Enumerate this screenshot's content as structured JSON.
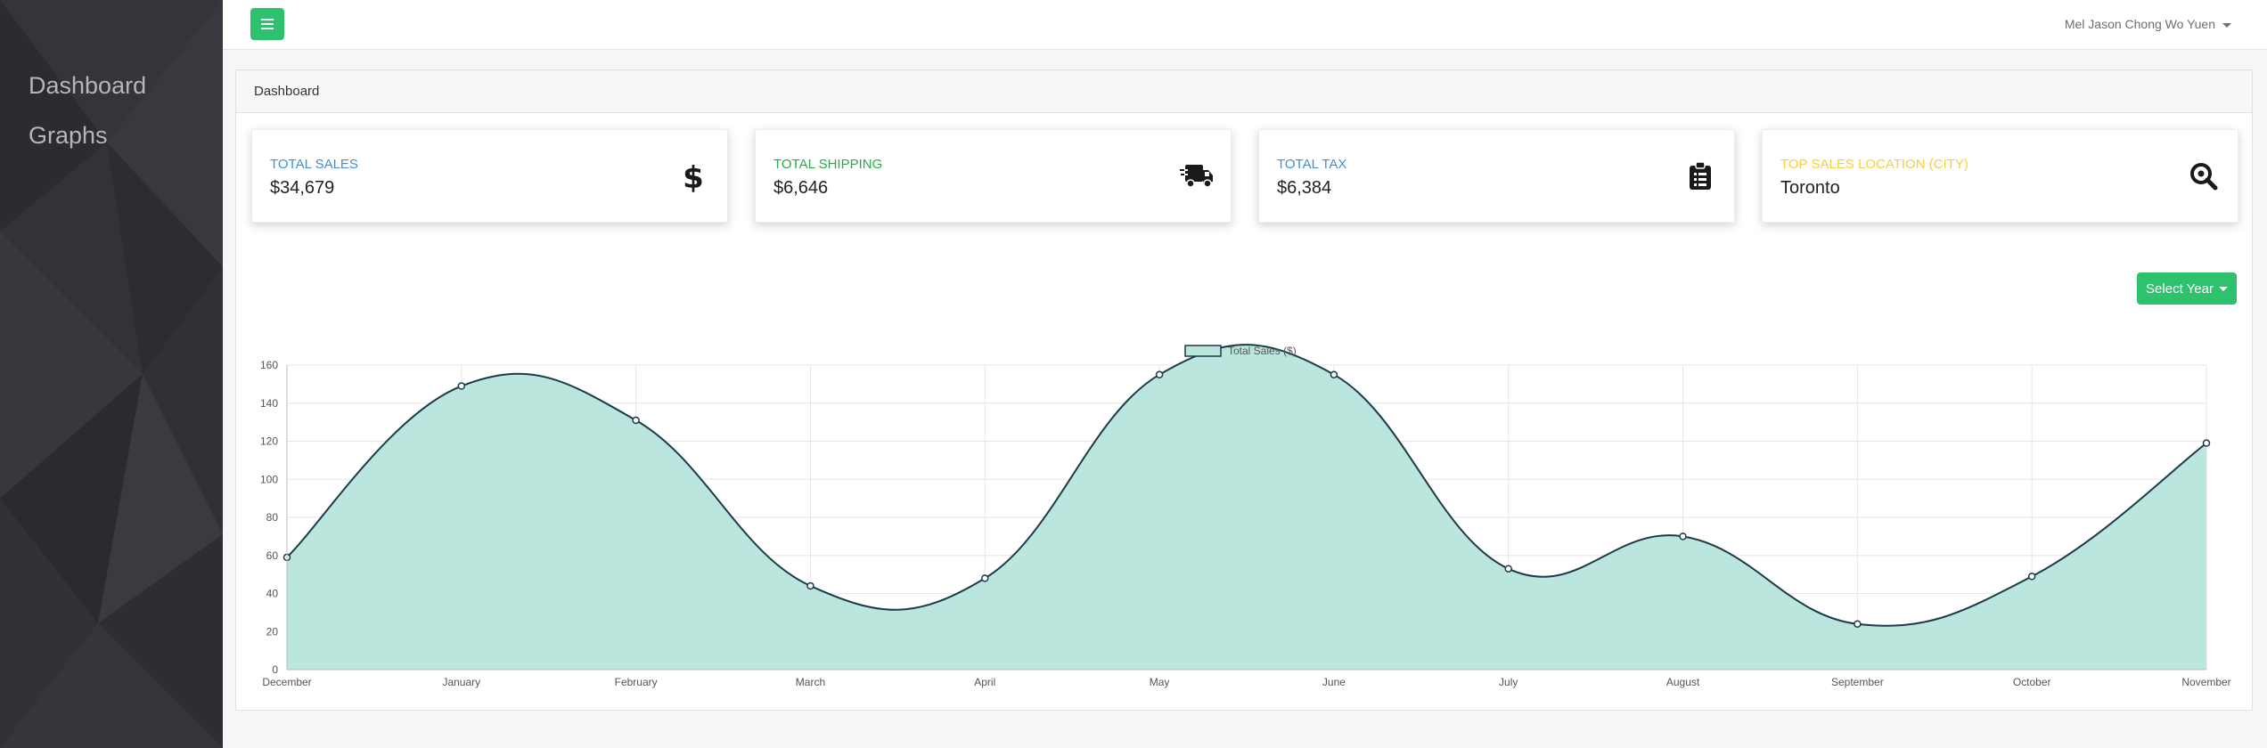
{
  "sidebar": {
    "items": [
      {
        "label": "Dashboard"
      },
      {
        "label": "Graphs"
      }
    ]
  },
  "topbar": {
    "menu_icon": "hamburger-icon",
    "user_name": "Mel Jason Chong Wo Yuen"
  },
  "panel": {
    "title": "Dashboard"
  },
  "stats": [
    {
      "label": "TOTAL SALES",
      "value": "$34,679",
      "color": "#3d8fe0",
      "icon": "dollar-icon"
    },
    {
      "label": "TOTAL SHIPPING",
      "value": "$6,646",
      "color": "#2ea84f",
      "icon": "shipping-truck-icon"
    },
    {
      "label": "TOTAL TAX",
      "value": "$6,384",
      "color": "#3d8fe0",
      "icon": "clipboard-icon"
    },
    {
      "label": "TOP SALES LOCATION (CITY)",
      "value": "Toronto",
      "color": "#f4d03f",
      "icon": "magnifier-icon"
    }
  ],
  "select_year": {
    "label": "Select Year"
  },
  "colors": {
    "accent_green": "#2ec26e",
    "sidebar_bg": "#2f3034",
    "area_fill": "#bbe6dd",
    "line": "#1d3a4a"
  },
  "chart_data": {
    "type": "area",
    "categories": [
      "December",
      "January",
      "February",
      "March",
      "April",
      "May",
      "June",
      "July",
      "August",
      "September",
      "October",
      "November"
    ],
    "series": [
      {
        "name": "Total Sales ($)",
        "values": [
          59,
          149,
          131,
          44,
          48,
          155,
          155,
          53,
          70,
          24,
          49,
          119
        ]
      }
    ],
    "ylim": [
      0,
      160
    ],
    "yticks": [
      0,
      20,
      40,
      60,
      80,
      100,
      120,
      140,
      160
    ],
    "legend": "top-center",
    "grid": true,
    "xlabel": "",
    "ylabel": ""
  }
}
